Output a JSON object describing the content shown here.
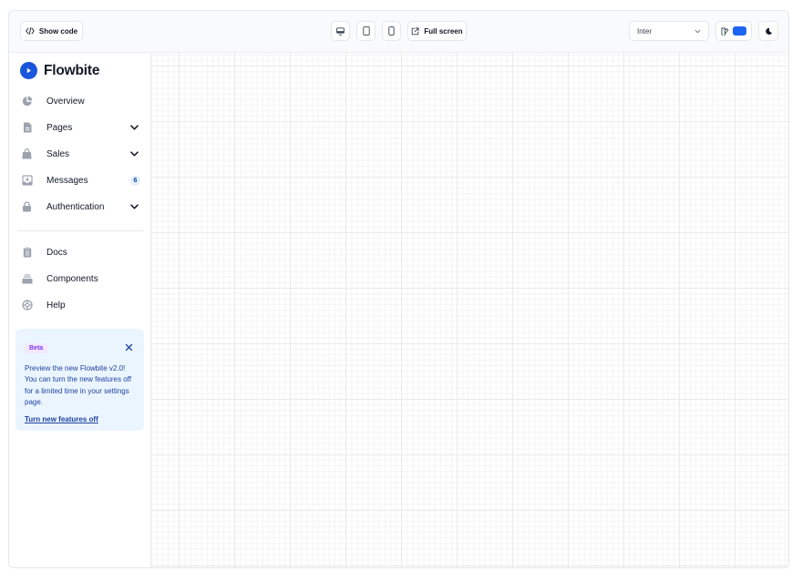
{
  "toolbar": {
    "show_code_label": "Show code",
    "devices": [
      {
        "name": "desktop",
        "icon": "desktop-icon"
      },
      {
        "name": "tablet",
        "icon": "tablet-icon"
      },
      {
        "name": "mobile",
        "icon": "mobile-icon"
      }
    ],
    "fullscreen_label": "Full screen",
    "font_select": {
      "value": "Inter"
    },
    "theme_color": "#1c64f2",
    "dark_mode_icon": "moon-icon"
  },
  "sidebar": {
    "brand": {
      "name": "Flowbite",
      "color": "#1a56db"
    },
    "items": [
      {
        "label": "Overview",
        "icon": "chart-pie-icon"
      },
      {
        "label": "Pages",
        "icon": "document-icon",
        "expandable": true
      },
      {
        "label": "Sales",
        "icon": "shopping-bag-icon",
        "expandable": true
      },
      {
        "label": "Messages",
        "icon": "inbox-icon",
        "badge": "6"
      },
      {
        "label": "Authentication",
        "icon": "lock-icon",
        "expandable": true
      }
    ],
    "secondary_items": [
      {
        "label": "Docs",
        "icon": "clipboard-icon"
      },
      {
        "label": "Components",
        "icon": "collection-icon"
      },
      {
        "label": "Help",
        "icon": "support-icon"
      }
    ],
    "cta": {
      "badge": "Beta",
      "text": "Preview the new Flowbite v2.0! You can turn the new features off for a limited time in your settings page.",
      "link": "Turn new features off"
    }
  }
}
